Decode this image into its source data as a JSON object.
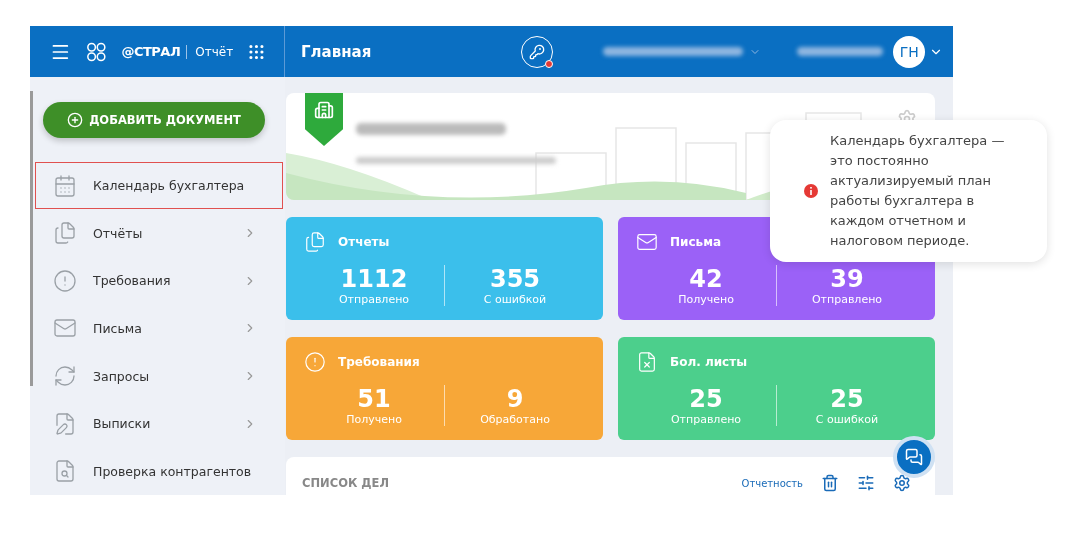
{
  "header": {
    "logo_text": "@СТРАЛ",
    "product": "Отчёт",
    "title": "Главная",
    "avatar": "ГН",
    "key_alert": true
  },
  "sidebar": {
    "add_button": "ДОБАВИТЬ ДОКУМЕНТ",
    "items": [
      {
        "label": "Календарь бухгалтера",
        "kind": "calendar",
        "arrow": false,
        "highlighted": true
      },
      {
        "label": "Отчёты",
        "kind": "files",
        "arrow": true,
        "highlighted": false
      },
      {
        "label": "Требования",
        "kind": "alert",
        "arrow": true,
        "highlighted": false
      },
      {
        "label": "Письма",
        "kind": "mail",
        "arrow": true,
        "highlighted": false
      },
      {
        "label": "Запросы",
        "kind": "refresh",
        "arrow": true,
        "highlighted": false
      },
      {
        "label": "Выписки",
        "kind": "edit",
        "arrow": true,
        "highlighted": false
      },
      {
        "label": "Проверка контрагентов",
        "kind": "search",
        "arrow": false,
        "highlighted": false
      }
    ]
  },
  "stats": [
    {
      "title": "Отчеты",
      "kind": "files",
      "color": "#3bbfeb",
      "values": [
        {
          "value": "1112",
          "label": "Отправлено"
        },
        {
          "value": "355",
          "label": "С ошибкой"
        }
      ]
    },
    {
      "title": "Письма",
      "kind": "mail",
      "color": "#9b61f7",
      "values": [
        {
          "value": "42",
          "label": "Получено"
        },
        {
          "value": "39",
          "label": "Отправлено"
        }
      ]
    },
    {
      "title": "Требования",
      "kind": "alert",
      "color": "#f7a738",
      "values": [
        {
          "value": "51",
          "label": "Получено"
        },
        {
          "value": "9",
          "label": "Обработано"
        }
      ]
    },
    {
      "title": "Бол. листы",
      "kind": "sick",
      "color": "#4ccf8c",
      "values": [
        {
          "value": "25",
          "label": "Отправлено"
        },
        {
          "value": "25",
          "label": "С ошибкой"
        }
      ]
    }
  ],
  "todo": {
    "title": "СПИСОК ДЕЛ",
    "link": "Отчетность"
  },
  "tooltip": {
    "text": "Календарь бухгалтера — это постоянно актуализируемый план работы бухгалтера в каждом отчетном и налоговом периоде."
  }
}
